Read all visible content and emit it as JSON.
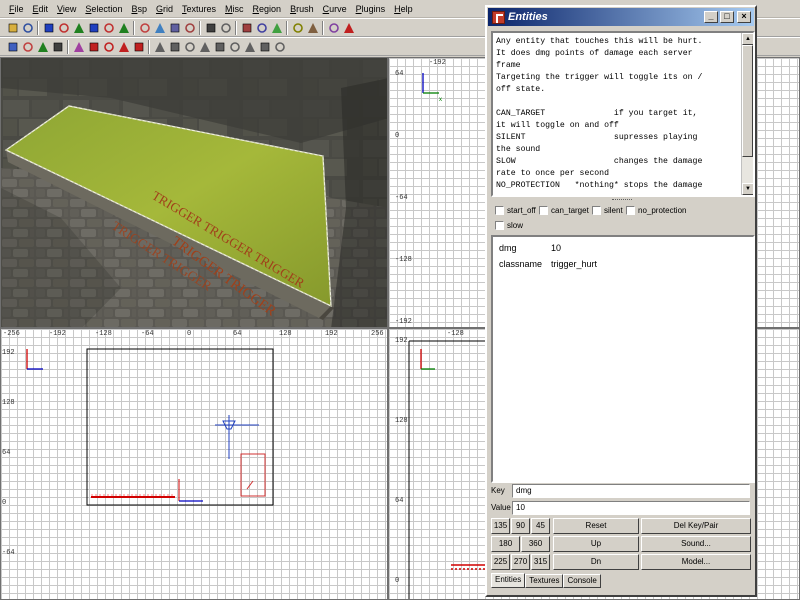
{
  "menu": [
    "File",
    "Edit",
    "View",
    "Selection",
    "Bsp",
    "Grid",
    "Textures",
    "Misc",
    "Region",
    "Brush",
    "Curve",
    "Plugins",
    "Help"
  ],
  "viewport_3d": {
    "floor_texture_text": "TRIGGER TRIGGER TRIGGER"
  },
  "views": {
    "xy": {
      "top_labels": [
        "-256",
        "-192",
        "-128",
        "-64",
        "0",
        "64",
        "128",
        "192",
        "256"
      ],
      "left_labels": [
        "192",
        "128",
        "64",
        "0",
        "-64"
      ]
    },
    "side_top": {
      "top_label": "-192",
      "left_labels": [
        "64",
        "0",
        "-64",
        "-128",
        "-192"
      ]
    },
    "side_bottom": {
      "top_label": "-128",
      "left_labels": [
        "192",
        "128",
        "64",
        "0"
      ]
    }
  },
  "entity_window": {
    "title": "Entities",
    "description": "Any entity that touches this will be hurt.\nIt does dmg points of damage each server\nframe\nTargeting the trigger will toggle its on /\noff state.\n\nCAN_TARGET              if you target it,\nit will toggle on and off\nSILENT                  supresses playing\nthe sound\nSLOW                    changes the damage\nrate to once per second\nNO_PROTECTION   *nothing* stops the damage",
    "flags": [
      "start_off",
      "can_target",
      "silent",
      "no_protection",
      "slow"
    ],
    "keyvalues": [
      {
        "key": "dmg",
        "value": "10"
      },
      {
        "key": "classname",
        "value": "trigger_hurt"
      }
    ],
    "key_label": "Key",
    "key_value": "dmg",
    "value_label": "Value",
    "value_value": "10",
    "angle_buttons": [
      "135",
      "90",
      "45",
      "180",
      "360",
      "225",
      "270",
      "315"
    ],
    "buttons": {
      "reset": "Reset",
      "del_key_pair": "Del Key/Pair",
      "up": "Up",
      "sound": "Sound...",
      "dn": "Dn",
      "model": "Model..."
    },
    "tabs": [
      "Entities",
      "Textures",
      "Console"
    ],
    "minimize": "_",
    "maximize": "□",
    "close": "×"
  }
}
